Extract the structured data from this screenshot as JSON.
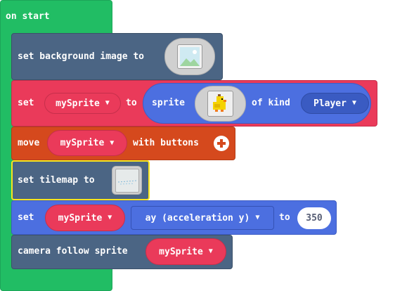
{
  "colors": {
    "loops": "#21bd64",
    "scene": "#4b6584",
    "sprites": "#ea3a5a",
    "sprite_pill": "#4c6fe0",
    "controller": "#d5491d",
    "selected_outline": "#f8e51f"
  },
  "hat": {
    "label": "on start"
  },
  "blocks": {
    "set_background": {
      "label": "set background image to",
      "icon": "image-icon"
    },
    "set_sprite": {
      "set_label": "set",
      "variable": "mySprite",
      "to_label": "to",
      "sprite_label": "sprite",
      "sprite_icon": "duck-sprite-icon",
      "of_kind_label": "of kind",
      "kind": "Player"
    },
    "move": {
      "label": "move",
      "variable": "mySprite",
      "with_label": "with buttons",
      "icon": "plus-circle-icon"
    },
    "set_tilemap": {
      "label": "set tilemap to",
      "icon": "tilemap-icon"
    },
    "set_property": {
      "set_label": "set",
      "variable": "mySprite",
      "property": "ay (acceleration y)",
      "to_label": "to",
      "value": "350"
    },
    "camera": {
      "label": "camera follow sprite",
      "variable": "mySprite"
    }
  }
}
